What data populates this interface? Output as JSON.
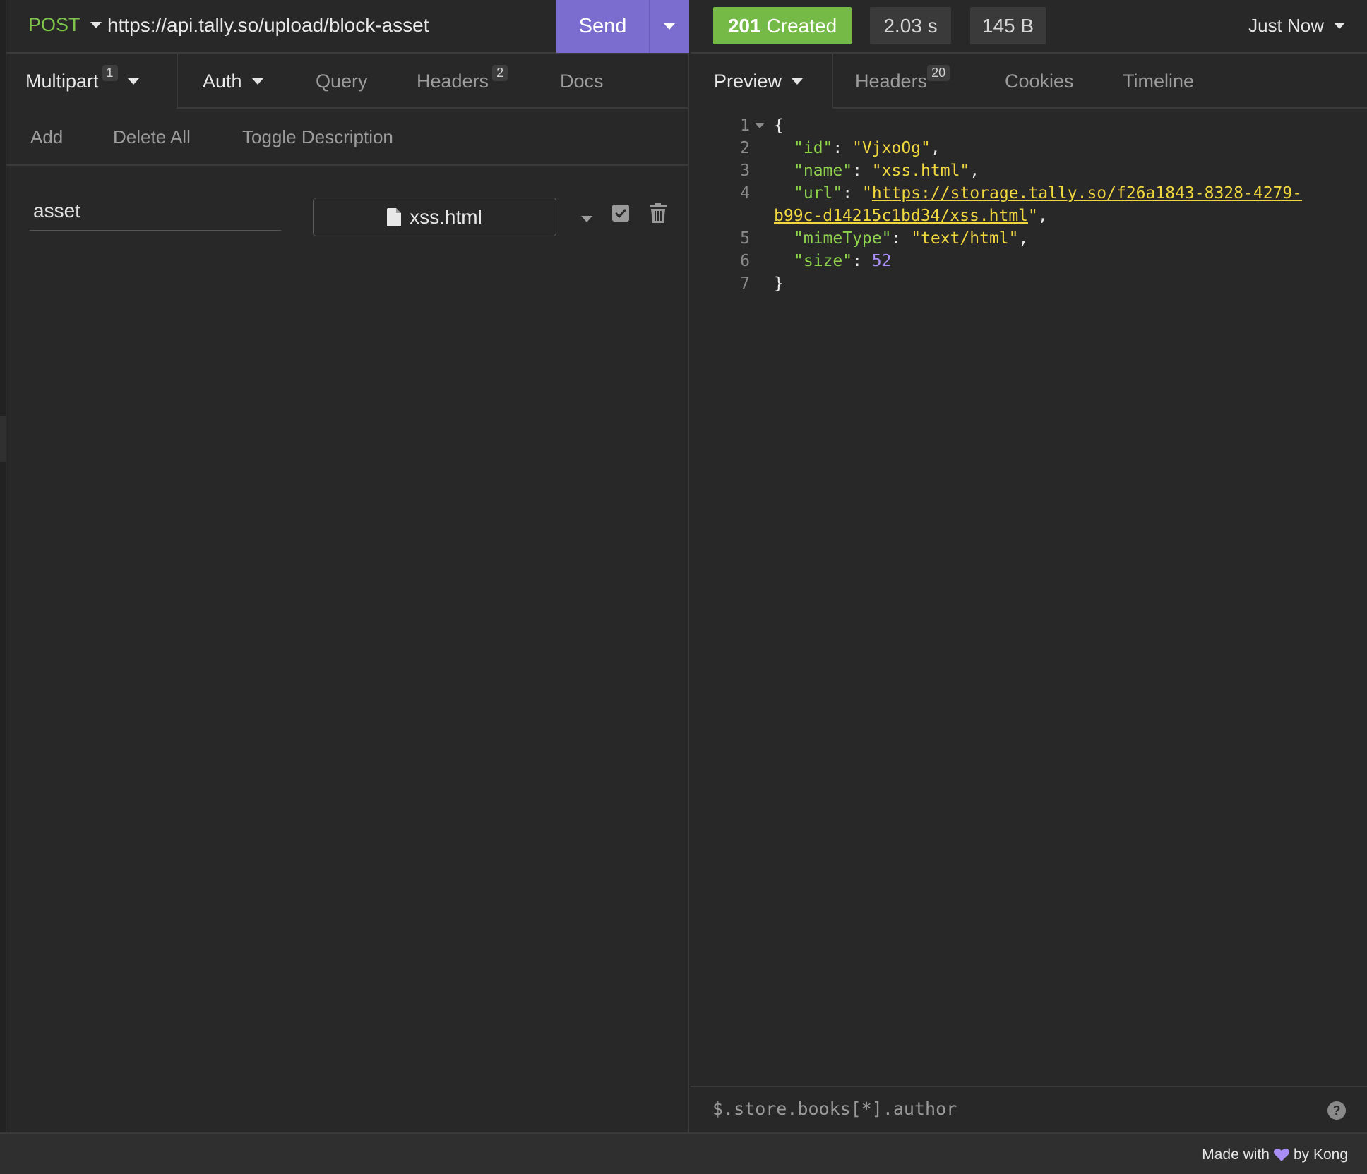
{
  "request": {
    "method": "POST",
    "url": "https://api.tally.so/upload/block-asset",
    "send_label": "Send"
  },
  "request_tabs": {
    "body": {
      "label": "Multipart",
      "count": "1"
    },
    "auth": {
      "label": "Auth"
    },
    "query": {
      "label": "Query"
    },
    "headers": {
      "label": "Headers",
      "count": "2"
    },
    "docs": {
      "label": "Docs"
    }
  },
  "body_toolbar": {
    "add": "Add",
    "delete_all": "Delete All",
    "toggle_description": "Toggle Description"
  },
  "params": [
    {
      "name": "asset",
      "file": "xss.html",
      "enabled": true
    }
  ],
  "response": {
    "status_code": "201",
    "status_text": "Created",
    "time": "2.03 s",
    "size": "145 B",
    "history": "Just Now",
    "status_color": "#75b946"
  },
  "response_tabs": {
    "preview": {
      "label": "Preview"
    },
    "headers": {
      "label": "Headers",
      "count": "20"
    },
    "cookies": {
      "label": "Cookies"
    },
    "timeline": {
      "label": "Timeline"
    }
  },
  "response_body": {
    "line_numbers": [
      "1",
      "2",
      "3",
      "4",
      "5",
      "6",
      "7"
    ],
    "id_key": "\"id\"",
    "id_value": "\"VjxoOg\"",
    "name_key": "\"name\"",
    "name_value": "\"xss.html\"",
    "url_key": "\"url\"",
    "url_value_part1": "https://storage.tally.so/f26a1843-8328-4279-",
    "url_value_part2": "b99c-d14215c1bd34/xss.html",
    "mime_key": "\"mimeType\"",
    "mime_value": "\"text/html\"",
    "size_key": "\"size\"",
    "size_value": "52"
  },
  "filter": {
    "placeholder": "$.store.books[*].author"
  },
  "footer": {
    "prefix": "Made with",
    "suffix": "by Kong",
    "heart_color": "#a98ff5"
  },
  "colors": {
    "accent": "#7b6ccf",
    "method": "#7ec44a",
    "json_key": "#8fd34d",
    "json_string": "#f0d63f",
    "json_number": "#a98ff5"
  }
}
